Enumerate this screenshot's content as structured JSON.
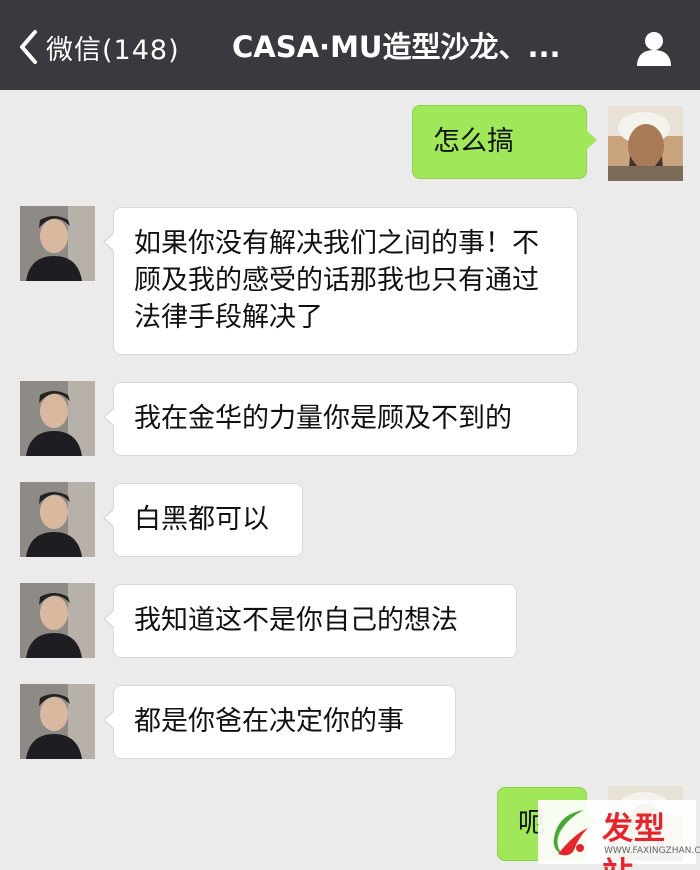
{
  "header": {
    "back_label": "微信(148)",
    "title": "CASA·MU造型沙龙、..."
  },
  "messages": [
    {
      "side": "right",
      "text": "怎么搞"
    },
    {
      "side": "left",
      "text": "如果你没有解决我们之间的事！不顾及我的感受的话那我也只有通过法律手段解决了"
    },
    {
      "side": "left",
      "text": "我在金华的力量你是顾及不到的"
    },
    {
      "side": "left",
      "text": "白黑都可以"
    },
    {
      "side": "left",
      "text": "我知道这不是你自己的想法"
    },
    {
      "side": "left",
      "text": "都是你爸在决定你的事"
    },
    {
      "side": "right",
      "text": "呃"
    }
  ],
  "watermark": {
    "brand": "发型站",
    "url": "WWW.FAXINGZHAN.COM"
  },
  "colors": {
    "header_bg": "#393a3f",
    "chat_bg": "#ebebeb",
    "sent_bubble": "#a0e75a",
    "received_bubble": "#ffffff",
    "watermark_red": "#e3262c"
  },
  "icons": {
    "back": "chevron-left-icon",
    "profile": "person-icon"
  }
}
